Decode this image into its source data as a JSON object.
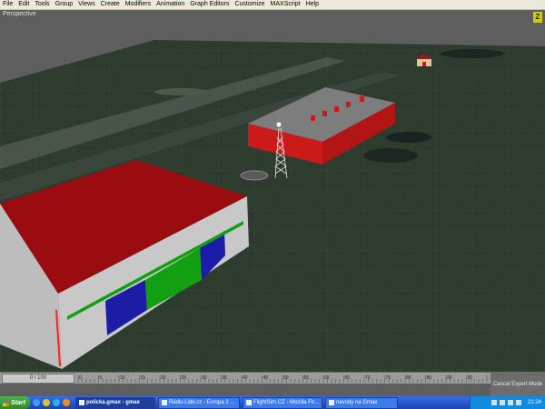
{
  "menu": [
    "File",
    "Edit",
    "Tools",
    "Group",
    "Views",
    "Create",
    "Modifiers",
    "Animation",
    "Graph Editors",
    "Customize",
    "MAXScript",
    "Help"
  ],
  "viewport": {
    "label": "Perspective",
    "gizmo": "Z"
  },
  "timeline": {
    "slider_label": "0 / 100",
    "ticks": [
      "0",
      "5",
      "10",
      "15",
      "20",
      "25",
      "30",
      "35",
      "40",
      "45",
      "50",
      "55",
      "60",
      "65",
      "70",
      "75",
      "80",
      "85",
      "90",
      "95",
      "100"
    ],
    "cancel_expert_label": "Cancel Expert Mode"
  },
  "taskbar": {
    "start_label": "Start",
    "quicklaunch": [
      "ie-icon",
      "chrome-icon",
      "skype-icon",
      "media-icon"
    ],
    "tasks": [
      {
        "label": "policka.gmax - gmax",
        "active": true
      },
      {
        "label": "Rádio.Lidé.cz - Evropa 2 ...",
        "active": false
      },
      {
        "label": "FlightSim.CZ - Mozilla Fir...",
        "active": false
      },
      {
        "label": "navody na Gmax",
        "active": false
      }
    ],
    "clock": "21:24"
  },
  "colors": {
    "roof": "#9a0c10",
    "wall": "#cc1a1a",
    "ground": "#2e3b2f",
    "sky": "#5e5e5e",
    "taskbar": "#2354c8"
  }
}
